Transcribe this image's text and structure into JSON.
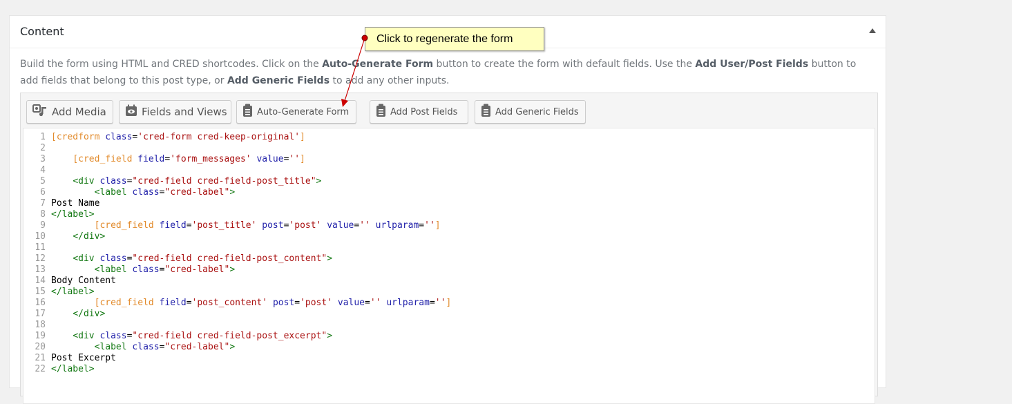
{
  "panel": {
    "title": "Content",
    "description": {
      "p1": "Build the form using HTML and CRED shortcodes. Click on the ",
      "b1": "Auto-Generate Form",
      "p2": " button to create the form with default fields. Use the ",
      "b2": "Add User/Post Fields",
      "p3": " button to add fields that belong to this post type, or ",
      "b3": "Add Generic Fields",
      "p4": " to add any other inputs."
    }
  },
  "toolbar": {
    "add_media": "Add Media",
    "fields_views": "Fields and Views",
    "auto_generate": "Auto-Generate Form",
    "add_post_fields": "Add Post Fields",
    "add_generic_fields": "Add Generic Fields"
  },
  "callout": {
    "text": "Click to regenerate the form"
  },
  "code_lines": [
    "1",
    "2",
    "3",
    "4",
    "5",
    "6",
    "7",
    "8",
    "9",
    "10",
    "11",
    "12",
    "13",
    "14",
    "15",
    "16",
    "17",
    "18",
    "19",
    "20",
    "21",
    "22"
  ],
  "code": {
    "l7": "Post Name",
    "l14": "Body Content",
    "l21": "Post Excerpt"
  },
  "colors": {
    "shortcode": "#e28a2a",
    "attribute": "#2222aa",
    "string": "#aa1111",
    "tag": "#117711",
    "callout_bg": "#ffffc0",
    "arrow": "#cc0000"
  },
  "icons": {
    "add_media": "media-icon",
    "fields_views": "eye-icon",
    "auto_generate": "form-icon",
    "add_post_fields": "form-icon",
    "add_generic_fields": "form-icon",
    "toggle": "triangle-up-icon"
  }
}
